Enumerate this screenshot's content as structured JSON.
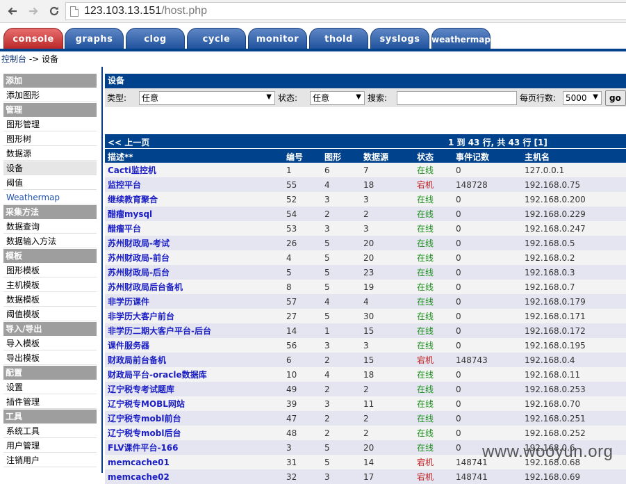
{
  "browser": {
    "url_host": "123.103.13.151",
    "url_path": "/host.php"
  },
  "tabs": [
    {
      "label": "console",
      "active": true
    },
    {
      "label": "graphs"
    },
    {
      "label": "clog"
    },
    {
      "label": "cycle"
    },
    {
      "label": "monitor"
    },
    {
      "label": "thold"
    },
    {
      "label": "syslogs"
    },
    {
      "label": "weathermap"
    }
  ],
  "breadcrumb": {
    "root": "控制台",
    "sep": " -> ",
    "current": "设备"
  },
  "sidebar": [
    {
      "type": "head",
      "label": "添加"
    },
    {
      "type": "item",
      "label": "添加图形"
    },
    {
      "type": "head",
      "label": "管理"
    },
    {
      "type": "item",
      "label": "图形管理"
    },
    {
      "type": "item",
      "label": "图形树"
    },
    {
      "type": "item",
      "label": "数据源"
    },
    {
      "type": "item",
      "label": "设备",
      "selected": true
    },
    {
      "type": "item",
      "label": "阈值"
    },
    {
      "type": "item",
      "label": "Weathermap",
      "blue": true
    },
    {
      "type": "head",
      "label": "采集方法"
    },
    {
      "type": "item",
      "label": "数据查询"
    },
    {
      "type": "item",
      "label": "数据输入方法"
    },
    {
      "type": "head",
      "label": "模板"
    },
    {
      "type": "item",
      "label": "图形模板"
    },
    {
      "type": "item",
      "label": "主机模板"
    },
    {
      "type": "item",
      "label": "数据模板"
    },
    {
      "type": "item",
      "label": "阈值模板"
    },
    {
      "type": "head",
      "label": "导入/导出"
    },
    {
      "type": "item",
      "label": "导入模板"
    },
    {
      "type": "item",
      "label": "导出模板"
    },
    {
      "type": "head",
      "label": "配置"
    },
    {
      "type": "item",
      "label": "设置"
    },
    {
      "type": "item",
      "label": "插件管理"
    },
    {
      "type": "head",
      "label": "工具"
    },
    {
      "type": "item",
      "label": "系统工具"
    },
    {
      "type": "item",
      "label": "用户管理"
    },
    {
      "type": "item",
      "label": "注销用户"
    }
  ],
  "filter": {
    "title": "设备",
    "type_label": "类型:",
    "type_value": "任意",
    "status_label": "状态:",
    "status_value": "任意",
    "search_label": "搜索:",
    "search_value": "",
    "rows_label": "每页行数:",
    "rows_value": "5000",
    "go_label": "go"
  },
  "nav": {
    "prev": "<< 上一页",
    "pager": "1 到 43 行, 共 43 行 [1]"
  },
  "columns": [
    "描述**",
    "编号",
    "图形",
    "数据源",
    "状态",
    "事件记数",
    "主机名"
  ],
  "rows": [
    {
      "desc": "Cacti监控机",
      "id": "1",
      "graphs": "6",
      "ds": "7",
      "status": "在线",
      "up": true,
      "events": "0",
      "host": "127.0.0.1"
    },
    {
      "desc": "监控平台",
      "id": "55",
      "graphs": "4",
      "ds": "18",
      "status": "宕机",
      "up": false,
      "events": "148728",
      "host": "192.168.0.75"
    },
    {
      "desc": "继续教育聚合",
      "id": "52",
      "graphs": "3",
      "ds": "3",
      "status": "在线",
      "up": true,
      "events": "0",
      "host": "192.168.0.200"
    },
    {
      "desc": "醋瘤mysql",
      "id": "54",
      "graphs": "2",
      "ds": "2",
      "status": "在线",
      "up": true,
      "events": "0",
      "host": "192.168.0.229"
    },
    {
      "desc": "醋瘤平台",
      "id": "53",
      "graphs": "3",
      "ds": "3",
      "status": "在线",
      "up": true,
      "events": "0",
      "host": "192.168.0.247"
    },
    {
      "desc": "苏州财政局-考试",
      "id": "26",
      "graphs": "5",
      "ds": "20",
      "status": "在线",
      "up": true,
      "events": "0",
      "host": "192.168.0.5"
    },
    {
      "desc": "苏州财政局-前台",
      "id": "4",
      "graphs": "5",
      "ds": "20",
      "status": "在线",
      "up": true,
      "events": "0",
      "host": "192.168.0.2"
    },
    {
      "desc": "苏州财政局-后台",
      "id": "5",
      "graphs": "5",
      "ds": "23",
      "status": "在线",
      "up": true,
      "events": "0",
      "host": "192.168.0.3"
    },
    {
      "desc": "苏州财政局后台备机",
      "id": "8",
      "graphs": "5",
      "ds": "19",
      "status": "在线",
      "up": true,
      "events": "0",
      "host": "192.168.0.7"
    },
    {
      "desc": "非学历课件",
      "id": "57",
      "graphs": "4",
      "ds": "4",
      "status": "在线",
      "up": true,
      "events": "0",
      "host": "192.168.0.179"
    },
    {
      "desc": "非学历大客户前台",
      "id": "27",
      "graphs": "5",
      "ds": "30",
      "status": "在线",
      "up": true,
      "events": "0",
      "host": "192.168.0.171"
    },
    {
      "desc": "非学历二期大客户平台-后台",
      "id": "14",
      "graphs": "1",
      "ds": "15",
      "status": "在线",
      "up": true,
      "events": "0",
      "host": "192.168.0.172"
    },
    {
      "desc": "课件服务器",
      "id": "56",
      "graphs": "3",
      "ds": "3",
      "status": "在线",
      "up": true,
      "events": "0",
      "host": "192.168.0.195"
    },
    {
      "desc": "财政局前台备机",
      "id": "6",
      "graphs": "2",
      "ds": "15",
      "status": "宕机",
      "up": false,
      "events": "148743",
      "host": "192.168.0.4"
    },
    {
      "desc": "财政局平台-oracle数据库",
      "id": "10",
      "graphs": "4",
      "ds": "18",
      "status": "在线",
      "up": true,
      "events": "0",
      "host": "192.168.0.11"
    },
    {
      "desc": "辽宁税专考试题库",
      "id": "49",
      "graphs": "2",
      "ds": "2",
      "status": "在线",
      "up": true,
      "events": "0",
      "host": "192.168.0.253"
    },
    {
      "desc": "辽宁税专MOBL网站",
      "id": "39",
      "graphs": "3",
      "ds": "11",
      "status": "在线",
      "up": true,
      "events": "0",
      "host": "192.168.0.70"
    },
    {
      "desc": "辽宁税专mobl前台",
      "id": "47",
      "graphs": "2",
      "ds": "2",
      "status": "在线",
      "up": true,
      "events": "0",
      "host": "192.168.0.251"
    },
    {
      "desc": "辽宁税专mobl后台",
      "id": "48",
      "graphs": "2",
      "ds": "2",
      "status": "在线",
      "up": true,
      "events": "0",
      "host": "192.168.0.252"
    },
    {
      "desc": "FLV课件平台-166",
      "id": "3",
      "graphs": "5",
      "ds": "20",
      "status": "在线",
      "up": true,
      "events": "0",
      "host": "192.168.0.6"
    },
    {
      "desc": "memcache01",
      "id": "31",
      "graphs": "5",
      "ds": "14",
      "status": "宕机",
      "up": false,
      "events": "148741",
      "host": "192.168.0.68"
    },
    {
      "desc": "memcache02",
      "id": "32",
      "graphs": "3",
      "ds": "17",
      "status": "宕机",
      "up": false,
      "events": "148741",
      "host": "192.168.0.69"
    }
  ],
  "watermark": "www.wooyun.org"
}
